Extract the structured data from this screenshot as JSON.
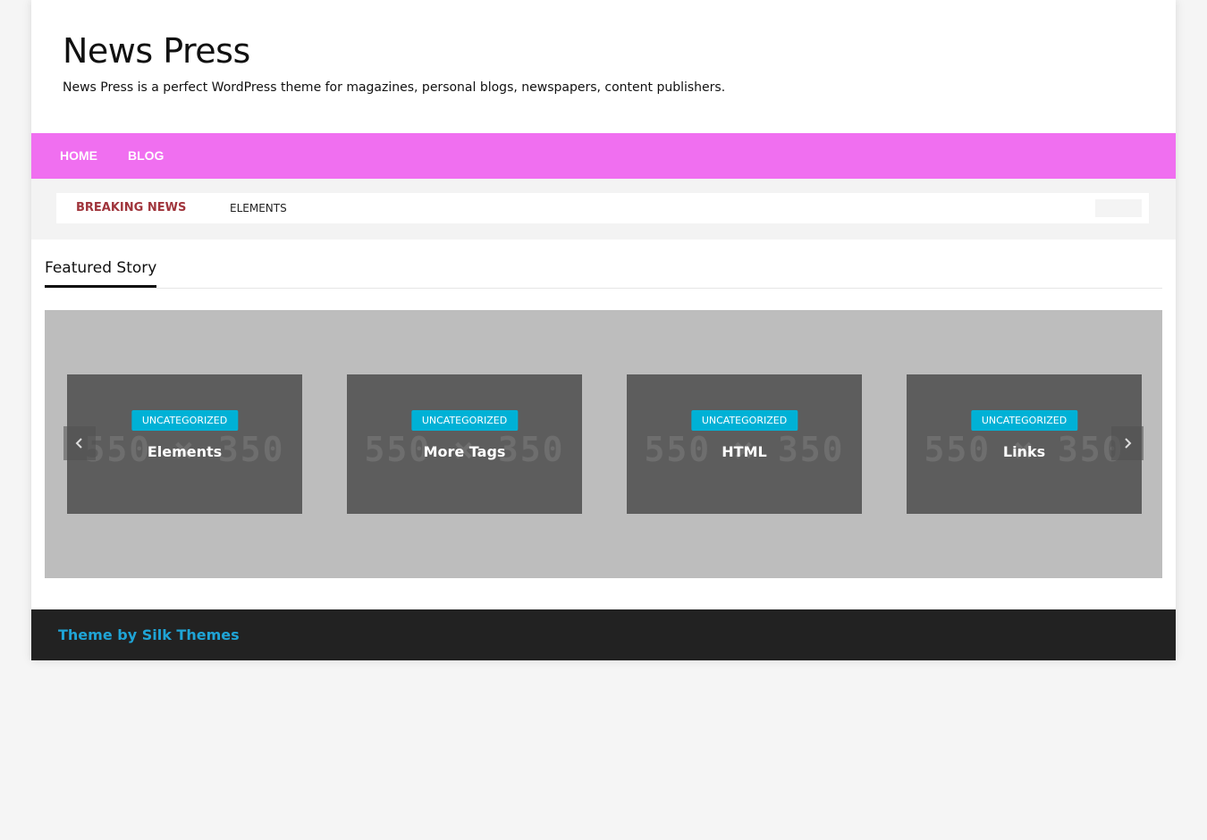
{
  "site": {
    "title": "News Press",
    "description": "News Press is a perfect WordPress theme for magazines, personal blogs, newspapers, content publishers."
  },
  "nav": {
    "items": [
      {
        "label": "HOME"
      },
      {
        "label": "BLOG"
      }
    ],
    "background_color": "#f06ff0"
  },
  "ticker": {
    "label": "BREAKING NEWS",
    "items": [
      "ELEMENTS"
    ]
  },
  "featured": {
    "heading": "Featured Story",
    "slides": [
      {
        "category": "UNCATEGORIZED",
        "title": "Elements",
        "placeholder": "550 × 350"
      },
      {
        "category": "UNCATEGORIZED",
        "title": "More Tags",
        "placeholder": "550 × 350"
      },
      {
        "category": "UNCATEGORIZED",
        "title": "HTML",
        "placeholder": "550 × 350"
      },
      {
        "category": "UNCATEGORIZED",
        "title": "Links",
        "placeholder": "550 × 350"
      }
    ],
    "prev_icon": "chevron-left-icon",
    "next_icon": "chevron-right-icon",
    "badge_color": "#00b1d6"
  },
  "footer": {
    "credit": "Theme by Silk Themes",
    "credit_color": "#1fa4d6"
  }
}
